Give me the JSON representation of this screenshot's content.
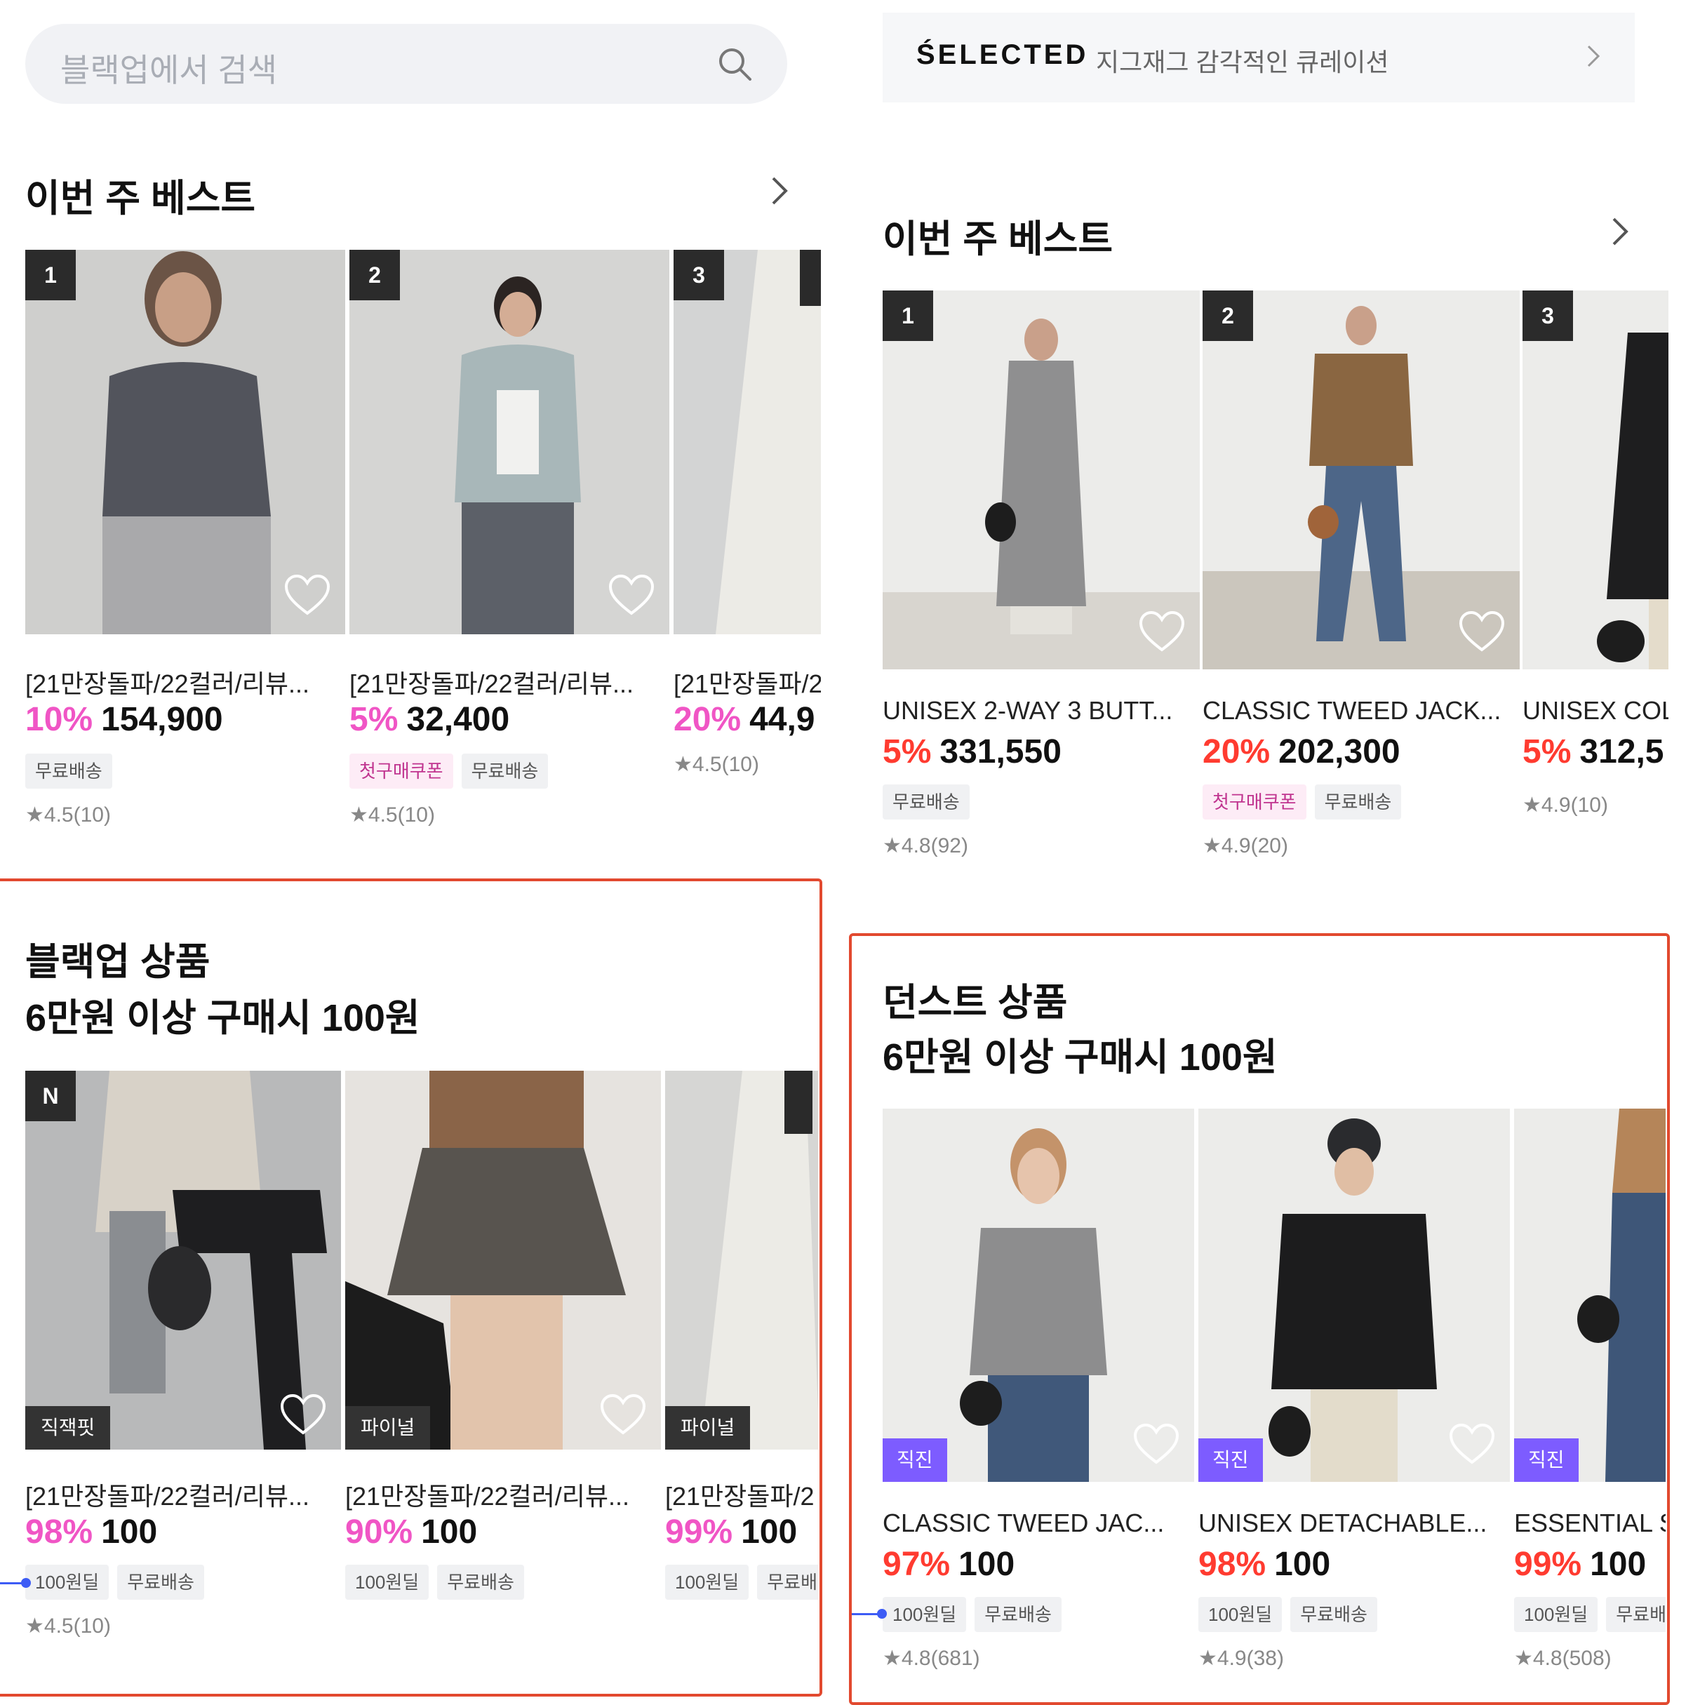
{
  "left": {
    "search_placeholder": "블랙업에서 검색",
    "best_title": "이번 주 베스트",
    "best_items": [
      {
        "rank": "1",
        "name": "[21만장돌파/22컬러/리뷰...",
        "discount": "10%",
        "price": "154,900",
        "badges": [
          "무료배송"
        ],
        "rating": "4.5(10)"
      },
      {
        "rank": "2",
        "name": "[21만장돌파/22컬러/리뷰...",
        "discount": "5%",
        "price": "32,400",
        "badges": [
          "첫구매쿠폰",
          "무료배송"
        ],
        "rating": "4.5(10)"
      },
      {
        "rank": "3",
        "name": "[21만장돌파/2",
        "discount": "20%",
        "price": "44,9",
        "badges": [],
        "rating": "4.5(10)"
      }
    ],
    "deal_title_line1": "블랙업 상품",
    "deal_title_line2": "6만원 이상 구매시 100원",
    "deal_items": [
      {
        "corner": "N",
        "tag": "직잭핏",
        "name": "[21만장돌파/22컬러/리뷰...",
        "discount": "98%",
        "price": "100",
        "badges": [
          "100원딜",
          "무료배송"
        ],
        "rating": "4.5(10)"
      },
      {
        "corner": "",
        "tag": "파이널",
        "name": "[21만장돌파/22컬러/리뷰...",
        "discount": "90%",
        "price": "100",
        "badges": [
          "100원딜",
          "무료배송"
        ],
        "rating": ""
      },
      {
        "corner": "",
        "tag": "파이널",
        "name": "[21만장돌파/2",
        "discount": "99%",
        "price": "100",
        "badges": [
          "100원딜",
          "무료배"
        ],
        "rating": ""
      }
    ]
  },
  "right": {
    "selected_brand": "ŚELECTED",
    "selected_sub": "지그재그 감각적인 큐레이션",
    "best_title": "이번 주 베스트",
    "best_items": [
      {
        "rank": "1",
        "name": "UNISEX 2-WAY 3 BUTT...",
        "discount": "5%",
        "price": "331,550",
        "badges": [
          "무료배송"
        ],
        "rating": "4.8(92)"
      },
      {
        "rank": "2",
        "name": "CLASSIC TWEED JACK...",
        "discount": "20%",
        "price": "202,300",
        "badges": [
          "첫구매쿠폰",
          "무료배송"
        ],
        "rating": "4.9(20)"
      },
      {
        "rank": "3",
        "name": "UNISEX COL",
        "discount": "5%",
        "price": "312,5",
        "badges": [],
        "rating": "4.9(10)"
      }
    ],
    "deal_title_line1": "던스트 상품",
    "deal_title_line2": "6만원 이상 구매시 100원",
    "deal_items": [
      {
        "tag": "직진",
        "name": "CLASSIC TWEED JAC...",
        "discount": "97%",
        "price": "100",
        "badges": [
          "100원딜",
          "무료배송"
        ],
        "rating": "4.8(681)"
      },
      {
        "tag": "직진",
        "name": "UNISEX DETACHABLE...",
        "discount": "98%",
        "price": "100",
        "badges": [
          "100원딜",
          "무료배송"
        ],
        "rating": "4.9(38)"
      },
      {
        "tag": "직진",
        "name": "ESSENTIAL S",
        "discount": "99%",
        "price": "100",
        "badges": [
          "100원딜",
          "무료배"
        ],
        "rating": "4.8(508)"
      }
    ]
  },
  "colors": {
    "pink_discount": "#f055c5",
    "red_discount": "#ff3b30",
    "highlight_box": "#e2492f",
    "purple_tag": "#7d5cff"
  },
  "icons": {
    "search": "search-icon",
    "chevron": "chevron-right-icon",
    "heart": "heart-outline-icon",
    "star": "star-icon"
  }
}
